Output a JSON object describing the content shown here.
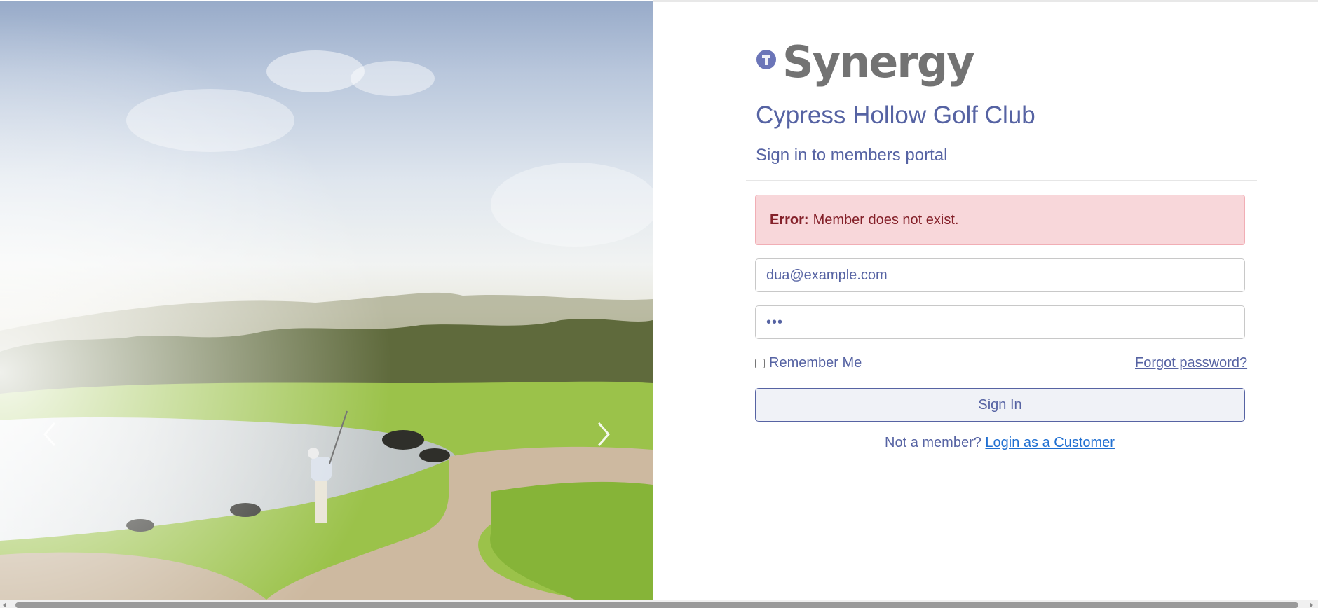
{
  "hero": {
    "carousel_prev_icon": "chevron-left-icon",
    "carousel_next_icon": "chevron-right-icon"
  },
  "brand": {
    "logo_text": "Synergy",
    "logo_icon": "synergy-logo-icon",
    "logo_text_color": "#737373",
    "accent_color": "#5663a3"
  },
  "header": {
    "club_name": "Cypress Hollow Golf Club",
    "subtitle": "Sign in to members portal"
  },
  "alert": {
    "label": "Error:",
    "message": "Member does not exist.",
    "background": "#f8d7da",
    "text_color": "#842029"
  },
  "form": {
    "email_value": "dua@example.com",
    "password_value": "•••",
    "remember_label": "Remember Me",
    "remember_checked": false,
    "forgot_label": "Forgot password?",
    "signin_label": "Sign In"
  },
  "footer": {
    "not_member_text": "Not a member?",
    "customer_link": "Login as a Customer"
  }
}
